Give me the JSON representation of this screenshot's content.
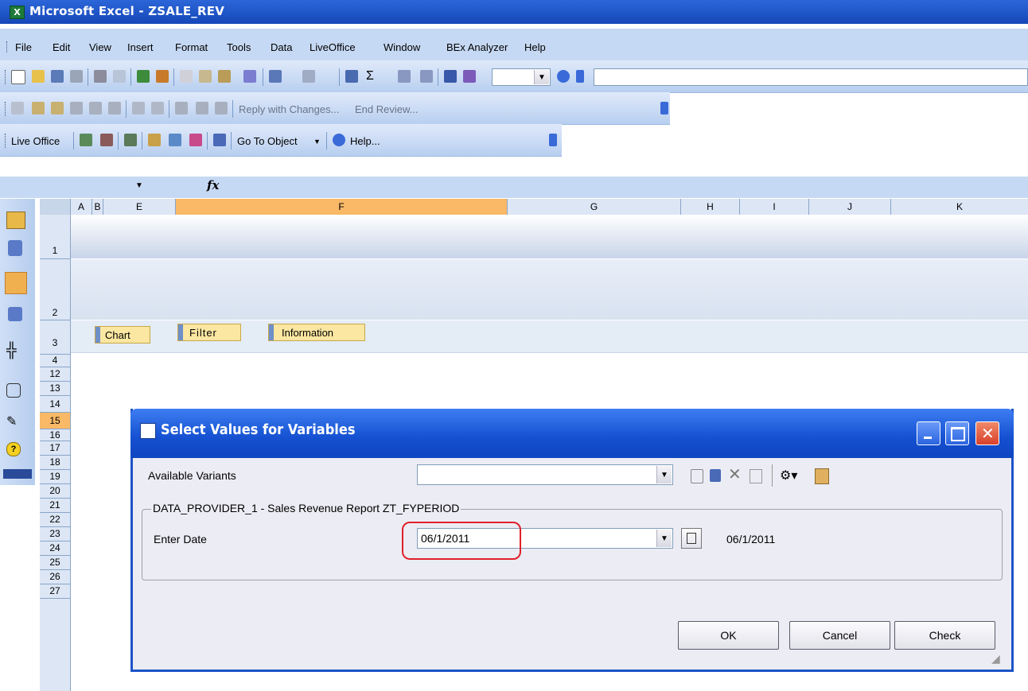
{
  "window": {
    "title": "Microsoft Excel - ZSALE_REV"
  },
  "menu": [
    "File",
    "Edit",
    "View",
    "Insert",
    "Format",
    "Tools",
    "Data",
    "LiveOffice",
    "Window",
    "BEx Analyzer",
    "Help"
  ],
  "reviewing_toolbar": {
    "reply": "Reply with Changes...",
    "end_review": "End Review..."
  },
  "liveoffice_toolbar": {
    "label": "Live Office",
    "goto": "Go To Object",
    "help": "Help..."
  },
  "formula_bar": {
    "fx": "fx"
  },
  "columns": [
    "A",
    "B",
    "E",
    "F",
    "G",
    "H",
    "I",
    "J",
    "K"
  ],
  "rows": [
    "1",
    "2",
    "3",
    "4",
    "12",
    "13",
    "14",
    "15",
    "16",
    "17",
    "18",
    "19",
    "20",
    "21",
    "22",
    "23",
    "24",
    "25",
    "26",
    "27"
  ],
  "sheet_buttons": {
    "chart": "Chart",
    "filter": "Filter",
    "information": "Information"
  },
  "dialog": {
    "title": "Select Values for Variables",
    "available_variants_label": "Available Variants",
    "available_variants_value": "",
    "group_label": "DATA_PROVIDER_1 - Sales Revenue Report ZT_FYPERIOD",
    "enter_date_label": "Enter Date",
    "enter_date_value": "06/1/2011",
    "enter_date_display": "06/1/2011",
    "ok": "OK",
    "cancel": "Cancel",
    "check": "Check"
  },
  "colors": {
    "titlebar": "#1547b8",
    "selected_col": "#f9b967",
    "highlight": "#e0202a"
  }
}
